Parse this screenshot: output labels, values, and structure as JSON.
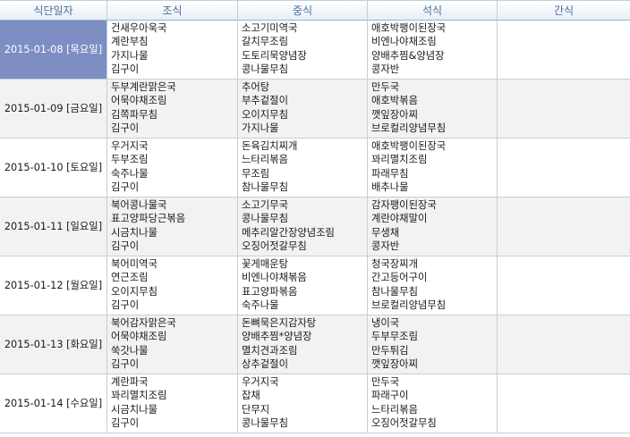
{
  "columns": [
    "식단일자",
    "조식",
    "중식",
    "석식",
    "간식"
  ],
  "rows": [
    {
      "date": "2015-01-08 [목요일]",
      "breakfast": [
        "건새우아욱국",
        "계란부침",
        "가지나물",
        "김구이"
      ],
      "lunch": [
        "소고기미역국",
        "갈치무조림",
        "도토리묵양념장",
        "콩나물무침"
      ],
      "dinner": [
        "애호박팽이된장국",
        "비엔나야채조림",
        "양배추찜&양념장",
        "콩자반"
      ],
      "snack": []
    },
    {
      "date": "2015-01-09 [금요일]",
      "breakfast": [
        "두부계란맑은국",
        "어묵야채조림",
        "김쪽파무침",
        "김구이"
      ],
      "lunch": [
        "추어탕",
        "부추겉절이",
        "오이지무침",
        "가지나물"
      ],
      "dinner": [
        "만두국",
        "애호박볶음",
        "깻잎장아찌",
        "브로컬리양념무침"
      ],
      "snack": []
    },
    {
      "date": "2015-01-10 [토요일]",
      "breakfast": [
        "우거지국",
        "두부조림",
        "숙주나물",
        "김구이"
      ],
      "lunch": [
        "돈육김치찌개",
        "느타리볶음",
        "무조림",
        "참나물무침"
      ],
      "dinner": [
        "애호박팽이된장국",
        "꽈리멸치조림",
        "파래무침",
        "배추나물"
      ],
      "snack": []
    },
    {
      "date": "2015-01-11 [일요일]",
      "breakfast": [
        "북어콩나물국",
        "표고양파당근볶음",
        "시금치나물",
        "김구이"
      ],
      "lunch": [
        "소고기무국",
        "콩나물무침",
        "메추리알간장양념조림",
        "오징어젓갈무침"
      ],
      "dinner": [
        "감자팽이된장국",
        "계란야채말이",
        "무생채",
        "콩자반"
      ],
      "snack": []
    },
    {
      "date": "2015-01-12 [월요일]",
      "breakfast": [
        "북어미역국",
        "연근조림",
        "오이지무침",
        "김구이"
      ],
      "lunch": [
        "꽃게매운탕",
        "비엔나야채볶음",
        "표고양파볶음",
        "숙주나물"
      ],
      "dinner": [
        "청국장찌개",
        "간고등어구이",
        "참나물무침",
        "브로컬리양념무침"
      ],
      "snack": []
    },
    {
      "date": "2015-01-13 [화요일]",
      "breakfast": [
        "북어감자맑은국",
        "어묵야채조림",
        "쑥갓나물",
        "김구이"
      ],
      "lunch": [
        "돈뼈묵은지감자탕",
        "양배추찜*양념장",
        "멸치견과조림",
        "상추겉절이"
      ],
      "dinner": [
        "냉이국",
        "두부무조림",
        "만두튀김",
        "깻잎장아찌"
      ],
      "snack": []
    },
    {
      "date": "2015-01-14 [수요일]",
      "breakfast": [
        "계란파국",
        "꽈리멸치조림",
        "시금치나물",
        "김구이"
      ],
      "lunch": [
        "우거지국",
        "잡채",
        "단무지",
        "콩나물무침"
      ],
      "dinner": [
        "만두국",
        "파래구이",
        "느타리볶음",
        "오징어젓갈무침"
      ],
      "snack": []
    }
  ]
}
